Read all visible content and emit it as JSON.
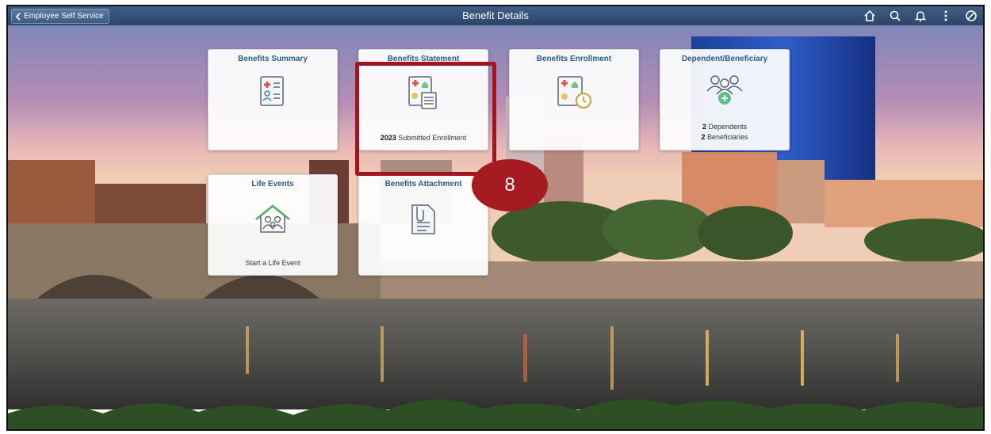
{
  "header": {
    "back_label": "Employee Self Service",
    "title": "Benefit Details",
    "icons": [
      "home-icon",
      "search-icon",
      "bell-icon",
      "more-icon",
      "navbar-icon"
    ]
  },
  "tiles": [
    {
      "title": "Benefits Summary",
      "info": []
    },
    {
      "title": "Benefits Statement",
      "info": [
        {
          "strong": "2023",
          "text": " Submitted Enrollment"
        }
      ]
    },
    {
      "title": "Benefits Enrollment",
      "info": []
    },
    {
      "title": "Dependent/Beneficiary",
      "info": [
        {
          "strong": "2",
          "text": " Dependents"
        },
        {
          "strong": "2",
          "text": " Beneficiaries"
        }
      ]
    },
    {
      "title": "Life Events",
      "info": [
        {
          "strong": "",
          "text": "Start a Life Event"
        }
      ]
    },
    {
      "title": "Benefits Attachment",
      "info": []
    }
  ],
  "step_badge": "8",
  "colors": {
    "accent": "#a3151e",
    "header": "#34527a",
    "tile_title": "#2b5b93"
  }
}
